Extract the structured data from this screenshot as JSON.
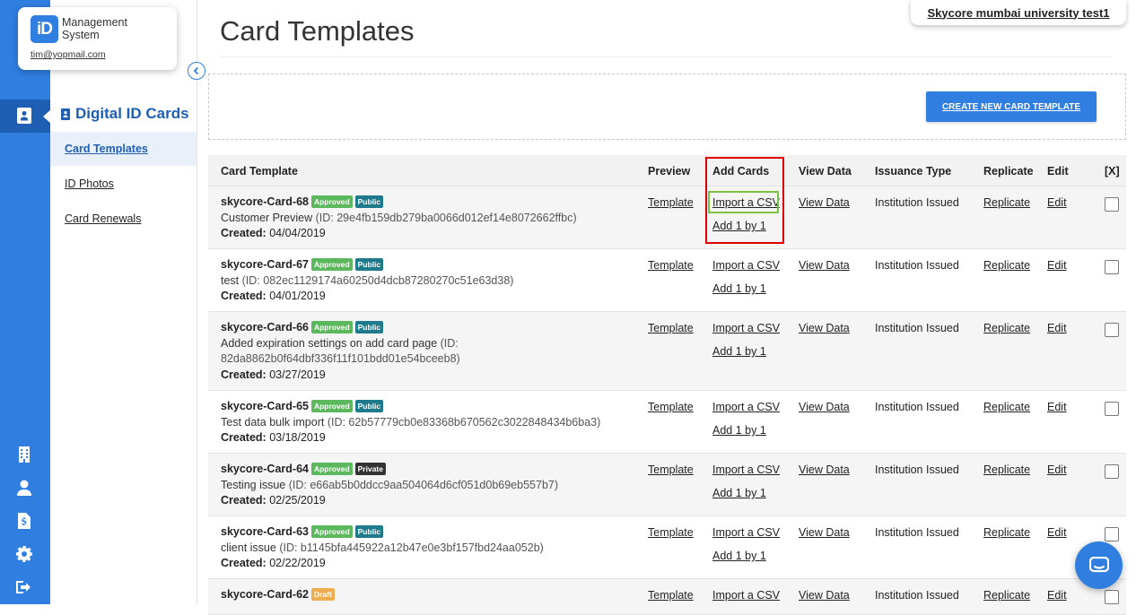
{
  "brand": {
    "logo_text": "iD",
    "name_line1": "Management",
    "name_line2": "System",
    "email": "tim@yopmail.com"
  },
  "org": {
    "name": "Skycore mumbai university test1"
  },
  "sidebar": {
    "section_title": "Digital ID Cards",
    "items": [
      {
        "label": "Card Templates",
        "active": true
      },
      {
        "label": "ID Photos",
        "active": false
      },
      {
        "label": "Card Renewals",
        "active": false
      }
    ]
  },
  "rail_icons": [
    "id-card-icon",
    "building-icon",
    "user-icon",
    "dollar-document-icon",
    "gear-icon",
    "logout-icon"
  ],
  "page": {
    "title": "Card Templates",
    "create_button": "CREATE NEW CARD TEMPLATE"
  },
  "table": {
    "headers": {
      "template": "Card Template",
      "preview": "Preview",
      "add_cards": "Add Cards",
      "view_data": "View Data",
      "issuance": "Issuance Type",
      "replicate": "Replicate",
      "edit": "Edit",
      "select": "[X]"
    },
    "links": {
      "preview": "Template",
      "import": "Import a CSV",
      "add_one": "Add 1 by 1",
      "view_data": "View Data",
      "replicate": "Replicate",
      "edit": "Edit"
    },
    "rows": [
      {
        "name": "skycore-Card-68",
        "status": "Approved",
        "visibility": "Public",
        "desc": "Customer Preview",
        "id_line1": "(ID: 29e4fb159db279ba0066d012ef14e8072662ffbc)",
        "id_line2": "",
        "created": "04/04/2019",
        "issuance": "Institution Issued"
      },
      {
        "name": "skycore-Card-67",
        "status": "Approved",
        "visibility": "Public",
        "desc": "test",
        "id_line1": "(ID: 082ec1129174a60250d4dcb87280270c51e63d38)",
        "id_line2": "",
        "created": "04/01/2019",
        "issuance": "Institution Issued"
      },
      {
        "name": "skycore-Card-66",
        "status": "Approved",
        "visibility": "Public",
        "desc": "Added expiration settings on add card page",
        "id_line1": "(ID:",
        "id_line2": "82da8862b0f64dbf336f11f101bdd01e54bceeb8)",
        "created": "03/27/2019",
        "issuance": "Institution Issued"
      },
      {
        "name": "skycore-Card-65",
        "status": "Approved",
        "visibility": "Public",
        "desc": "Test data bulk import",
        "id_line1": "(ID: 62b57779cb0e83368b670562c3022848434b6ba3)",
        "id_line2": "",
        "created": "03/18/2019",
        "issuance": "Institution Issued"
      },
      {
        "name": "skycore-Card-64",
        "status": "Approved",
        "visibility": "Private",
        "desc": "Testing issue",
        "id_line1": "(ID: e66ab5b0ddcc9aa504064d6cf051d0b69eb557b7)",
        "id_line2": "",
        "created": "02/25/2019",
        "issuance": "Institution Issued"
      },
      {
        "name": "skycore-Card-63",
        "status": "Approved",
        "visibility": "Public",
        "desc": "client issue",
        "id_line1": "(ID: b1145bfa445922a12b47e0e3bf157fbd24aa052b)",
        "id_line2": "",
        "created": "02/22/2019",
        "issuance": "Institution Issued"
      },
      {
        "name": "skycore-Card-62",
        "status": "Draft",
        "visibility": "",
        "desc": "",
        "id_line1": "",
        "id_line2": "",
        "created": "",
        "issuance": "Institution Issued"
      }
    ],
    "created_label": "Created:"
  },
  "colors": {
    "primary": "#2f7ee0",
    "primary_dark": "#1f5fb3",
    "approved": "#5cb85c",
    "public": "#1f7a8c",
    "private": "#333333",
    "draft": "#f0ad4e",
    "highlight_red": "#e00000",
    "highlight_green": "#7bc142"
  }
}
